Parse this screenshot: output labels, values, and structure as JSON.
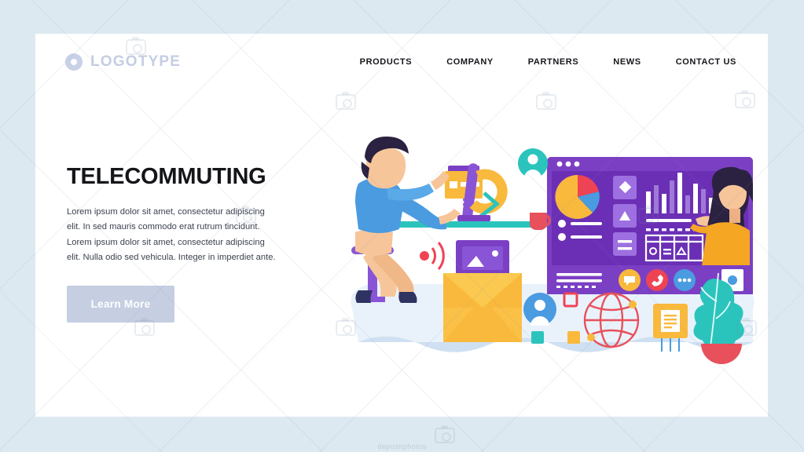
{
  "page": {
    "background_color": "#dde9f0",
    "card_color": "#ffffff",
    "watermark_text": "depositphotos"
  },
  "header": {
    "brand": {
      "mark_icon": "ring-logo-icon",
      "text": "LOGOTYPE",
      "color": "#c4cde3"
    },
    "nav": [
      {
        "id": "products",
        "label": "PRODUCTS"
      },
      {
        "id": "company",
        "label": "COMPANY"
      },
      {
        "id": "partners",
        "label": "PARTNERS"
      },
      {
        "id": "news",
        "label": "NEWS"
      },
      {
        "id": "contact-us",
        "label": "CONTACT US"
      }
    ]
  },
  "hero": {
    "title": "TELECOMMUTING",
    "body": "Lorem ipsum dolor sit amet, consectetur adipiscing elit. In sed mauris commodo erat rutrum tincidunt. Lorem ipsum dolor sit amet, consectetur adipiscing elit. Nulla  odio sed vehicula. Integer in imperdiet ante.",
    "cta_label": "Learn More",
    "cta_color": "#c6cee2",
    "title_color": "#141519"
  },
  "illustration": {
    "name": "telecommuting-video-call-scene",
    "palette": {
      "purple": "#7b3fc4",
      "purple_light": "#9d6fe0",
      "purple_deep": "#6b2fb5",
      "violet": "#8a54d6",
      "yellow": "#f9b93c",
      "yellow_light": "#fbc94f",
      "blue": "#4a9be0",
      "blue_dark": "#3b3d6b",
      "teal": "#2bc4bd",
      "red": "#ef4354",
      "coral": "#e8505b",
      "skin": "#f7c59a",
      "navy": "#2f3361",
      "ground": "#cfe0f2",
      "ground_light": "#e8f1fa",
      "white": "#ffffff"
    },
    "elements": [
      {
        "name": "ground-blob",
        "label": "wavy floor blob"
      },
      {
        "name": "person-at-desk",
        "label": "man sitting on stool at desk"
      },
      {
        "name": "desk",
        "label": "teal desk surface"
      },
      {
        "name": "desktop-monitor",
        "label": "purple monitor on desk"
      },
      {
        "name": "coffee-cup",
        "label": "red coffee cup"
      },
      {
        "name": "folder-icon",
        "label": "yellow folder with purple tab"
      },
      {
        "name": "avatar-badge-teal",
        "label": "teal user avatar badge"
      },
      {
        "name": "wifi-signal-icon",
        "label": "red wifi signal waves"
      },
      {
        "name": "email-envelope",
        "label": "yellow envelope with purple message card"
      },
      {
        "name": "video-call-window",
        "label": "purple video conference dashboard window"
      },
      {
        "name": "woman-on-call",
        "label": "woman in yellow sweater presenting"
      },
      {
        "name": "pie-chart",
        "label": "pie chart widget"
      },
      {
        "name": "bar-chart",
        "label": "bar chart widget"
      },
      {
        "name": "data-table",
        "label": "table widget with icons"
      },
      {
        "name": "tile-diamond",
        "label": "diamond tile button"
      },
      {
        "name": "tile-triangle",
        "label": "triangle tile button"
      },
      {
        "name": "tile-lines",
        "label": "lines tile button"
      },
      {
        "name": "chat-button",
        "label": "yellow chat bubble button"
      },
      {
        "name": "hangup-button",
        "label": "red hang up phone button"
      },
      {
        "name": "more-button",
        "label": "blue more options button"
      },
      {
        "name": "record-button",
        "label": "white record button with blue dot"
      },
      {
        "name": "avatar-badge-blue",
        "label": "blue user avatar badge"
      },
      {
        "name": "globe-icon",
        "label": "red wireframe globe"
      },
      {
        "name": "document-icon",
        "label": "yellow document card"
      },
      {
        "name": "potted-plant",
        "label": "teal plant in red pot"
      }
    ],
    "chart_widgets": {
      "pie_slices": [
        {
          "label": "slice-a",
          "value": 62,
          "color": "#f9b93c"
        },
        {
          "label": "slice-b",
          "value": 22,
          "color": "#ef4354"
        },
        {
          "label": "slice-c",
          "value": 16,
          "color": "#4a9be0"
        }
      ],
      "bar_values": [
        34,
        52,
        30,
        68,
        100,
        26,
        58,
        46,
        22
      ],
      "bar_colors": [
        "#ffffff",
        "#a079d8",
        "#ffffff",
        "#a079d8",
        "#ffffff",
        "#a079d8",
        "#ffffff",
        "#a079d8",
        "#ffffff"
      ]
    }
  }
}
